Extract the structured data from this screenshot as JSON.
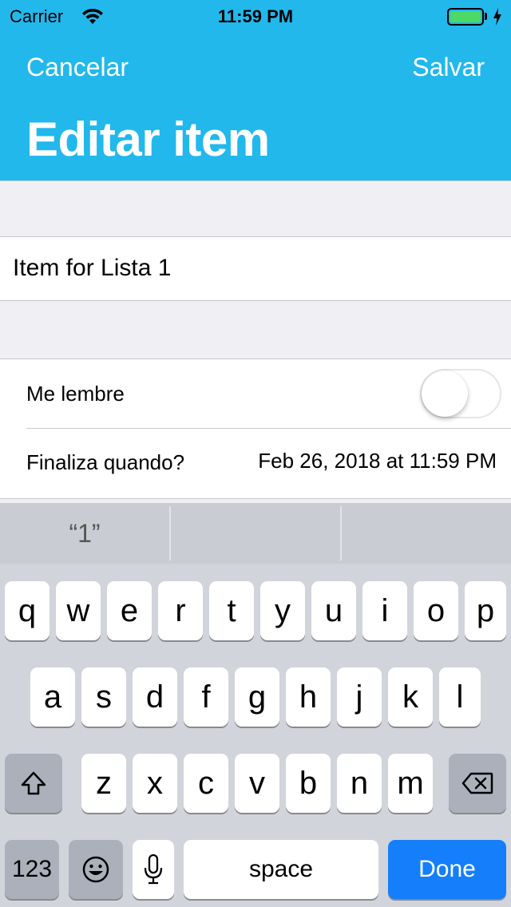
{
  "status_bar": {
    "carrier": "Carrier",
    "time": "11:59 PM"
  },
  "nav": {
    "cancel_label": "Cancelar",
    "save_label": "Salvar",
    "title": "Editar item"
  },
  "form": {
    "item_name_value": "Item for Lista 1",
    "remind_label": "Me lembre",
    "remind_on": false,
    "due_label": "Finaliza quando?",
    "due_value": "Feb 26, 2018 at 11:59 PM"
  },
  "keyboard": {
    "predictions": [
      "“1”",
      "",
      ""
    ],
    "row1": [
      "q",
      "w",
      "e",
      "r",
      "t",
      "y",
      "u",
      "i",
      "o",
      "p"
    ],
    "row2": [
      "a",
      "s",
      "d",
      "f",
      "g",
      "h",
      "j",
      "k",
      "l"
    ],
    "row3": [
      "z",
      "x",
      "c",
      "v",
      "b",
      "n",
      "m"
    ],
    "numbers_label": "123",
    "space_label": "space",
    "done_label": "Done"
  },
  "colors": {
    "nav_bar": "#22b8ec",
    "done_key": "#147efb",
    "battery": "#4cd964"
  }
}
